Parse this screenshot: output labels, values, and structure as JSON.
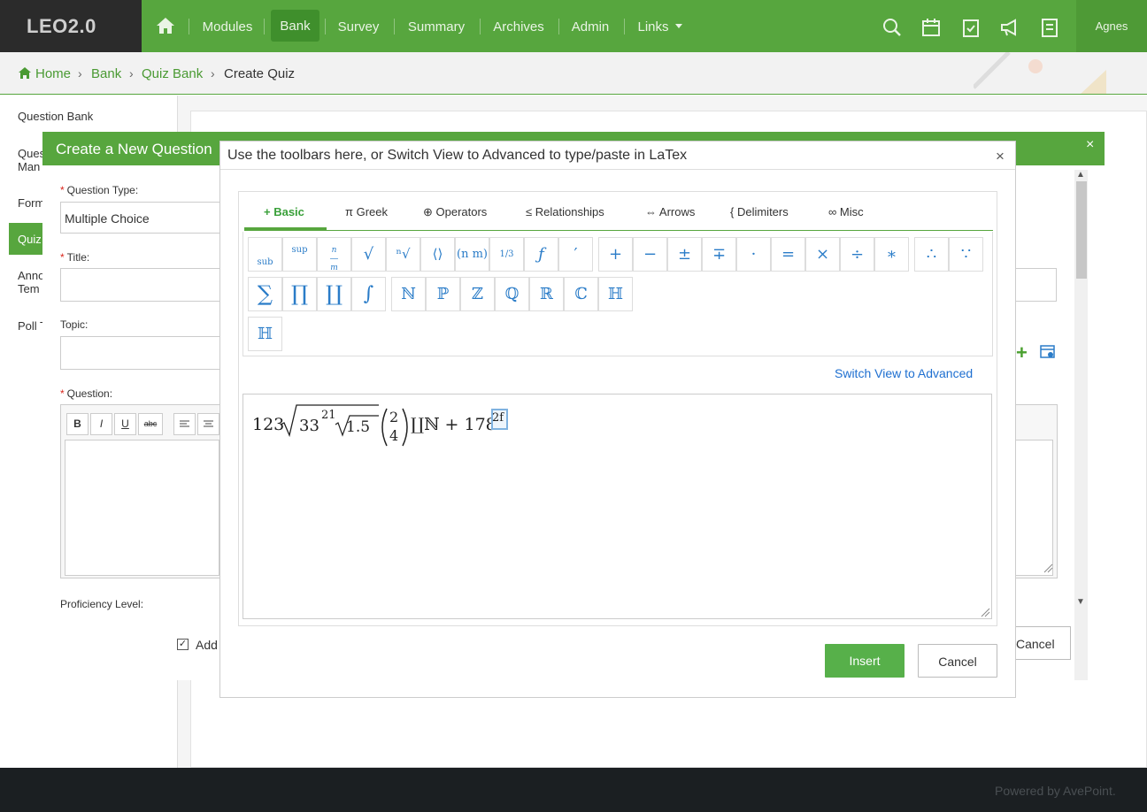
{
  "app": {
    "logo": "LEO2.0",
    "user": "Agnes"
  },
  "nav": {
    "items": [
      {
        "label": "Modules"
      },
      {
        "label": "Bank"
      },
      {
        "label": "Survey"
      },
      {
        "label": "Summary"
      },
      {
        "label": "Archives"
      },
      {
        "label": "Admin"
      },
      {
        "label": "Links"
      }
    ],
    "right_icons": [
      "search-icon",
      "calendar-icon",
      "task-icon",
      "megaphone-icon",
      "document-icon"
    ]
  },
  "breadcrumb": {
    "items": [
      "Home",
      "Bank",
      "Quiz Bank",
      "Create Quiz"
    ]
  },
  "sidebar": {
    "items": [
      {
        "label": "Question Bank"
      },
      {
        "label": "Ques"
      },
      {
        "label": "Man"
      },
      {
        "label": "Form"
      },
      {
        "label": "Quiz"
      },
      {
        "label": "Anno"
      },
      {
        "label": "Tem"
      },
      {
        "label": "Poll T"
      }
    ]
  },
  "question_dialog": {
    "title": "Create a New Question",
    "question_type_label": "Question Type:",
    "question_type_value": "Multiple Choice",
    "title_label": "Title:",
    "topic_label": "Topic:",
    "question_label": "Question:",
    "proficiency_label": "Proficiency Level:",
    "add_label": "Add",
    "cancel_label": "Cancel",
    "format_buttons": [
      "B",
      "I",
      "U",
      "abc"
    ]
  },
  "equation_dialog": {
    "title": "Use the toolbars here, or Switch View to Advanced to type/paste in LaTex",
    "tabs": [
      {
        "label": "+ Basic"
      },
      {
        "label": "π Greek"
      },
      {
        "label": "⊕ Operators"
      },
      {
        "label": "≤ Relationships"
      },
      {
        "label": "⇔ Arrows"
      },
      {
        "label": "{ Delimiters"
      },
      {
        "label": "∞ Misc"
      }
    ],
    "toolbar_row1": [
      "sub",
      "sup",
      "n/m",
      "√",
      "ⁿ√",
      "⟨⟩",
      "(n m)",
      "1/3",
      "ƒ",
      "′",
      "+",
      "−",
      "±",
      "∓",
      "·",
      "=",
      "×",
      "÷",
      "∗",
      "∴",
      "∵"
    ],
    "toolbar_row2": [
      "∑",
      "∏",
      "∐",
      "∫",
      "ℕ",
      "ℙ",
      "ℤ",
      "ℚ",
      "ℝ",
      "ℂ",
      "ℍ"
    ],
    "toolbar_row3": [
      "ℍ"
    ],
    "switch_view": "Switch View to Advanced",
    "formula": {
      "p1": "123",
      "p2": "33",
      "p3": "21",
      "p4": "1.5",
      "p5": "2",
      "p6": "4",
      "p7": "∐ℕ + 178",
      "p8": "2f"
    },
    "insert": "Insert",
    "cancel": "Cancel"
  },
  "footer": {
    "text": "Powered by AvePoint."
  }
}
